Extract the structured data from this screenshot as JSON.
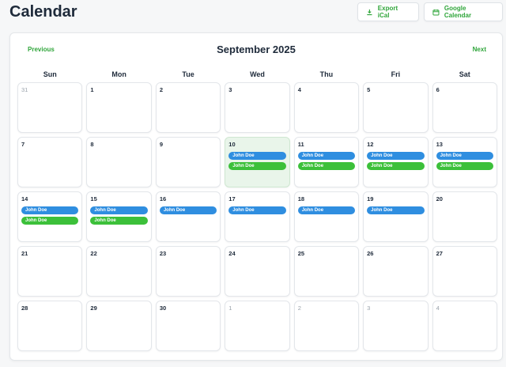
{
  "header": {
    "title": "Calendar",
    "export_label": "Export iCal",
    "google_label": "Google Calendar"
  },
  "nav": {
    "prev_label": "Previous",
    "next_label": "Next",
    "month_label": "September 2025"
  },
  "colors": {
    "accent": "#2fa53a",
    "event_blue": "#2f8ee0",
    "event_green": "#3cc03a",
    "today_bg": "#e9f5ea"
  },
  "weekdays": [
    "Sun",
    "Mon",
    "Tue",
    "Wed",
    "Thu",
    "Fri",
    "Sat"
  ],
  "days": [
    {
      "num": "31",
      "muted": true,
      "events": []
    },
    {
      "num": "1",
      "events": []
    },
    {
      "num": "2",
      "events": []
    },
    {
      "num": "3",
      "events": []
    },
    {
      "num": "4",
      "events": []
    },
    {
      "num": "5",
      "events": []
    },
    {
      "num": "6",
      "events": []
    },
    {
      "num": "7",
      "events": []
    },
    {
      "num": "8",
      "events": []
    },
    {
      "num": "9",
      "events": []
    },
    {
      "num": "10",
      "today": true,
      "events": [
        {
          "label": "John Doe",
          "color": "blue"
        },
        {
          "label": "John Doe",
          "color": "green"
        }
      ]
    },
    {
      "num": "11",
      "events": [
        {
          "label": "John Doe",
          "color": "blue"
        },
        {
          "label": "John Doe",
          "color": "green"
        }
      ]
    },
    {
      "num": "12",
      "events": [
        {
          "label": "John Doe",
          "color": "blue"
        },
        {
          "label": "John Doe",
          "color": "green"
        }
      ]
    },
    {
      "num": "13",
      "events": [
        {
          "label": "John Doe",
          "color": "blue"
        },
        {
          "label": "John Doe",
          "color": "green"
        }
      ]
    },
    {
      "num": "14",
      "events": [
        {
          "label": "John Doe",
          "color": "blue"
        },
        {
          "label": "John Doe",
          "color": "green"
        }
      ]
    },
    {
      "num": "15",
      "events": [
        {
          "label": "John Doe",
          "color": "blue"
        },
        {
          "label": "John Doe",
          "color": "green"
        }
      ]
    },
    {
      "num": "16",
      "events": [
        {
          "label": "John Doe",
          "color": "blue"
        }
      ]
    },
    {
      "num": "17",
      "events": [
        {
          "label": "John Doe",
          "color": "blue"
        }
      ]
    },
    {
      "num": "18",
      "events": [
        {
          "label": "John Doe",
          "color": "blue"
        }
      ]
    },
    {
      "num": "19",
      "events": [
        {
          "label": "John Doe",
          "color": "blue"
        }
      ]
    },
    {
      "num": "20",
      "events": []
    },
    {
      "num": "21",
      "events": []
    },
    {
      "num": "22",
      "events": []
    },
    {
      "num": "23",
      "events": []
    },
    {
      "num": "24",
      "events": []
    },
    {
      "num": "25",
      "events": []
    },
    {
      "num": "26",
      "events": []
    },
    {
      "num": "27",
      "events": []
    },
    {
      "num": "28",
      "events": []
    },
    {
      "num": "29",
      "events": []
    },
    {
      "num": "30",
      "events": []
    },
    {
      "num": "1",
      "muted": true,
      "events": []
    },
    {
      "num": "2",
      "muted": true,
      "events": []
    },
    {
      "num": "3",
      "muted": true,
      "events": []
    },
    {
      "num": "4",
      "muted": true,
      "events": []
    }
  ]
}
